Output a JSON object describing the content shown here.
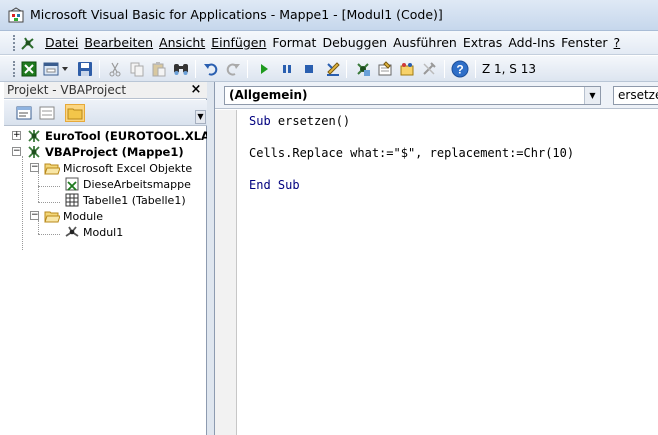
{
  "window": {
    "title": "Microsoft Visual Basic for Applications - Mappe1 - [Modul1 (Code)]"
  },
  "menu": {
    "items": [
      {
        "label": "Datei",
        "underline": true
      },
      {
        "label": "Bearbeiten",
        "underline": true
      },
      {
        "label": "Ansicht",
        "underline": true
      },
      {
        "label": "Einfügen",
        "underline": true
      },
      {
        "label": "Format",
        "underline": false
      },
      {
        "label": "Debuggen",
        "underline": false
      },
      {
        "label": "Ausführen",
        "underline": false
      },
      {
        "label": "Extras",
        "underline": false
      },
      {
        "label": "Add-Ins",
        "underline": false
      },
      {
        "label": "Fenster",
        "underline": false
      },
      {
        "label": "?",
        "underline": true
      }
    ]
  },
  "toolbar": {
    "cursor_position": "Z 1, S 13",
    "icons": [
      "excel-icon",
      "insert-userform-icon",
      "save-icon",
      "cut-icon",
      "copy-icon",
      "paste-icon",
      "find-icon",
      "undo-icon",
      "redo-icon",
      "run-icon",
      "break-icon",
      "reset-icon",
      "design-mode-icon",
      "project-explorer-icon",
      "properties-icon",
      "object-browser-icon",
      "toolbox-icon",
      "help-icon"
    ]
  },
  "project_panel": {
    "title": "Projekt - VBAProject",
    "close_label": "×",
    "tree": {
      "eurotool": "EuroTool (EUROTOOL.XLAM)",
      "vbaproject": "VBAProject (Mappe1)",
      "excel_objects": "Microsoft Excel Objekte",
      "workbook": "DieseArbeitsmappe",
      "sheet1": "Tabelle1 (Tabelle1)",
      "modules": "Module",
      "module1": "Modul1"
    }
  },
  "code_window": {
    "object_combo": "(Allgemein)",
    "procedure_combo": "ersetzen",
    "lines": {
      "l1_kw": "Sub",
      "l1_rest": " ersetzen()",
      "l2": "Cells.Replace what:=\"$\", replacement:=Chr(10)",
      "l3": "End Sub"
    }
  },
  "colors": {
    "keyword": "#00007f",
    "selected_tool": "#fbd682"
  }
}
